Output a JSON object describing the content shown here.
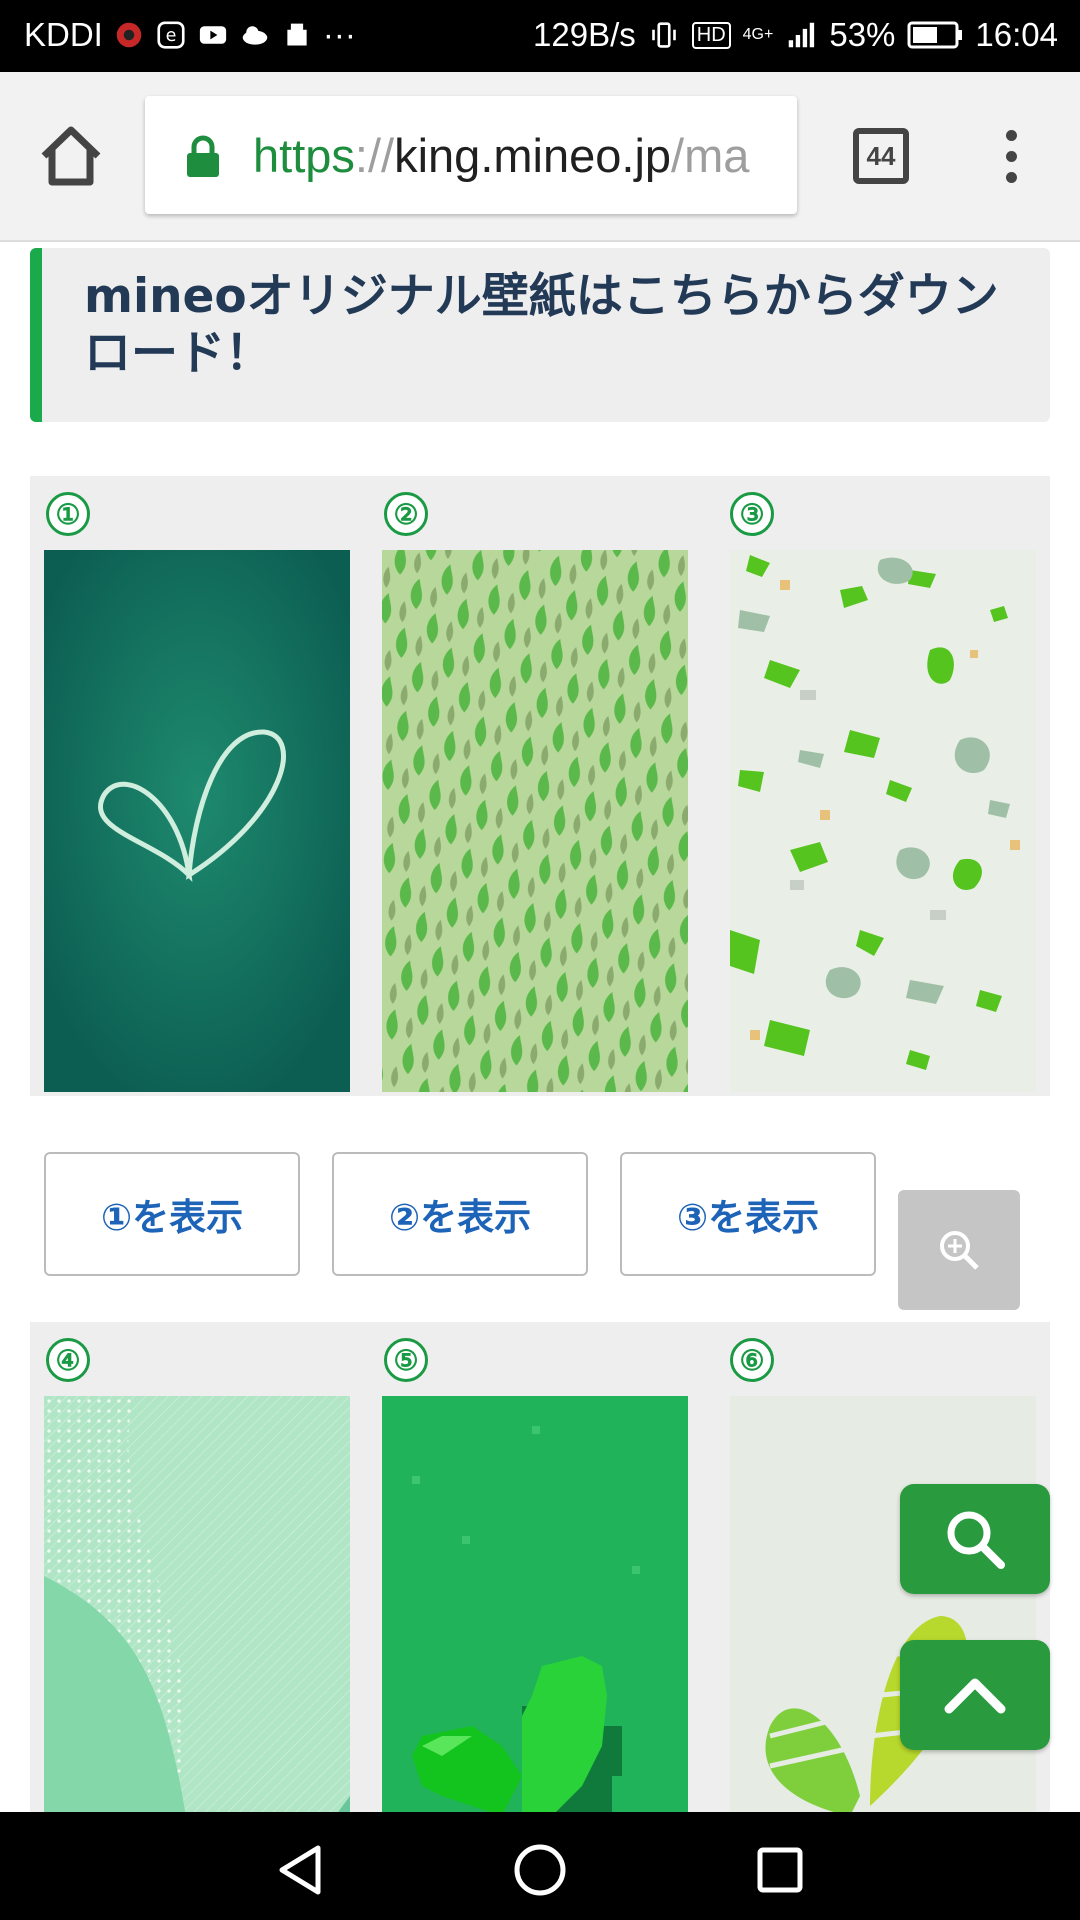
{
  "status_bar": {
    "carrier": "KDDI",
    "net_speed": "129B/s",
    "hd_badge": "HD",
    "network": "4G+",
    "battery": "53%",
    "time": "16:04",
    "icons": [
      "app-icon",
      "e-icon",
      "youtube-icon",
      "cloud-icon",
      "box-icon",
      "more-dots-icon",
      "vibrate-icon",
      "signal-icon",
      "battery-icon"
    ]
  },
  "browser": {
    "url_scheme": "https",
    "url_separator": "://",
    "url_host": "king.mineo.jp",
    "url_rest": "/ma",
    "tab_count": "44"
  },
  "page": {
    "heading": "mineoオリジナル壁紙はこちらからダウンロード！",
    "gallery1": {
      "numbers": [
        "①",
        "②",
        "③"
      ]
    },
    "buttons": [
      "①を表示",
      "②を表示",
      "③を表示"
    ],
    "gallery2": {
      "numbers": [
        "④",
        "⑤",
        "⑥"
      ]
    }
  },
  "colors": {
    "accent_green": "#1aaa4b",
    "heading_text": "#233a57",
    "button_text": "#1d63b8",
    "fab_green": "#2a9a3e"
  }
}
